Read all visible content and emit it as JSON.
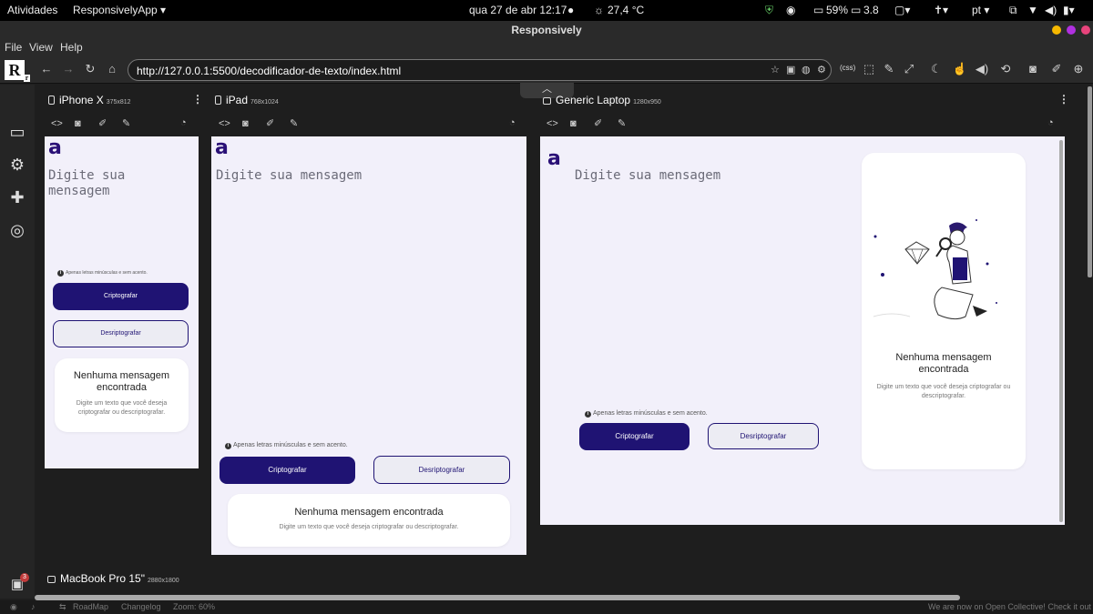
{
  "topbar": {
    "activities": "Atividades",
    "app_menu": "ResponsivelyApp ▾",
    "datetime": "qua 27 de abr  12:17",
    "weather": "27,4 °C",
    "battery": "59%",
    "cpu": "3.8",
    "language": "pt ▾"
  },
  "window": {
    "title": "Responsively"
  },
  "menu": {
    "file": "File",
    "view": "View",
    "help": "Help"
  },
  "address": {
    "url": "http://127.0.0.1:5500/decodificador-de-texto/index.html",
    "css_badge": "(css)"
  },
  "devices": {
    "iphone": {
      "name": "iPhone X",
      "dim": "375x812"
    },
    "ipad": {
      "name": "iPad",
      "dim": "768x1024"
    },
    "laptop": {
      "name": "Generic Laptop",
      "dim": "1280x950"
    },
    "macbook": {
      "name": "MacBook Pro 15\"",
      "dim": "2880x1800"
    }
  },
  "page": {
    "logo": "a",
    "placeholder": "Digite sua mensagem",
    "hint": "Apenas letras minúsculas e sem acento.",
    "encrypt": "Criptografar",
    "decrypt": "Desriptografar",
    "card_title": "Nenhuma mensagem encontrada",
    "card_text": "Digite um texto que você deseja criptografar ou descriptografar."
  },
  "rail": {
    "gift_count": "3"
  },
  "status": {
    "roadmap": "RoadMap",
    "changelog": "Changelog",
    "zoom": "Zoom: 60%",
    "notice": "We are now on Open Collective! Check it out"
  },
  "colors": {
    "brand": "#1f1373",
    "page_bg": "#f2f0fa",
    "app_bg": "#1e1e1e"
  }
}
